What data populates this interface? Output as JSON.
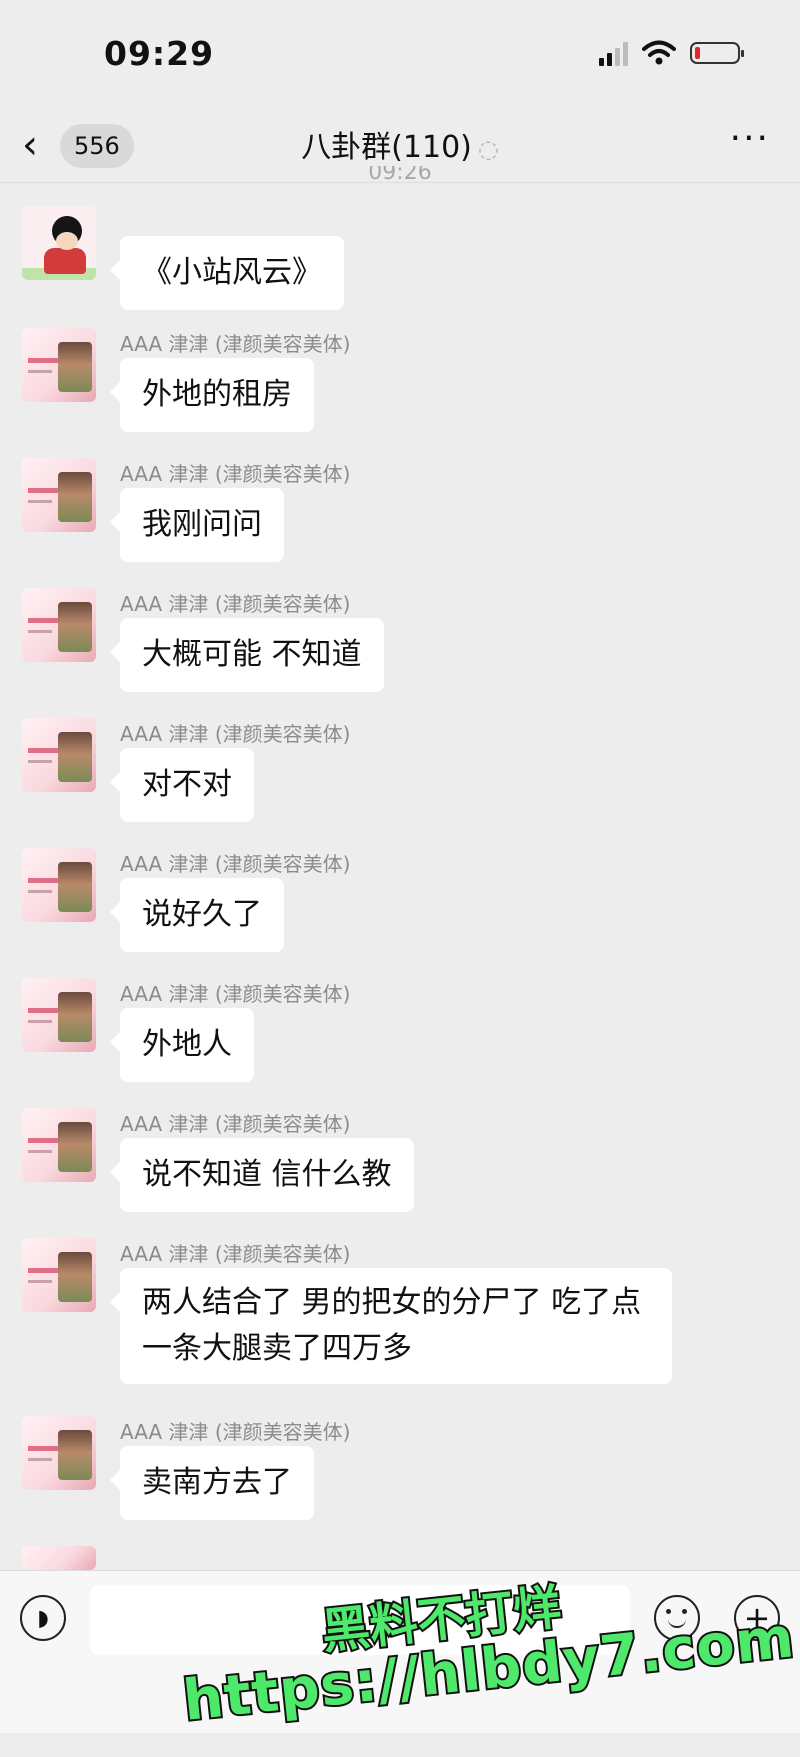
{
  "status_bar": {
    "time": "09:29",
    "battery_level": 0.12,
    "battery_color": "#e0262c"
  },
  "nav": {
    "back_icon": "chevron-left-icon",
    "unread_count": "556",
    "title": "八卦群(110)",
    "muted_icon": "ear-icon",
    "more_icon": "ellipsis-icon"
  },
  "partial_timestamp": "09:26",
  "messages": [
    {
      "sender": "",
      "text": "《小站风云》"
    },
    {
      "sender": "AAA 津津 (津颜美容美体)",
      "text": "外地的租房"
    },
    {
      "sender": "AAA 津津 (津颜美容美体)",
      "text": "我刚问问"
    },
    {
      "sender": "AAA 津津 (津颜美容美体)",
      "text": "大概可能 不知道"
    },
    {
      "sender": "AAA 津津 (津颜美容美体)",
      "text": "对不对"
    },
    {
      "sender": "AAA 津津 (津颜美容美体)",
      "text": "说好久了"
    },
    {
      "sender": "AAA 津津 (津颜美容美体)",
      "text": "外地人"
    },
    {
      "sender": "AAA 津津 (津颜美容美体)",
      "text": "说不知道 信什么教"
    },
    {
      "sender": "AAA 津津 (津颜美容美体)",
      "text_line1": "两人结合了 男的把女的分尸了 吃了点",
      "text_line2": "一条大腿卖了四万多"
    },
    {
      "sender": "AAA 津津 (津颜美容美体)",
      "text": "卖南方去了"
    }
  ],
  "input_bar": {
    "voice_icon": "voice-icon",
    "emoji_icon": "emoji-icon",
    "plus_icon": "plus-icon"
  },
  "watermark": {
    "line1": "黑料不打烊",
    "line2": "https://hlbdy7.com",
    "color": "#4ee86a"
  }
}
